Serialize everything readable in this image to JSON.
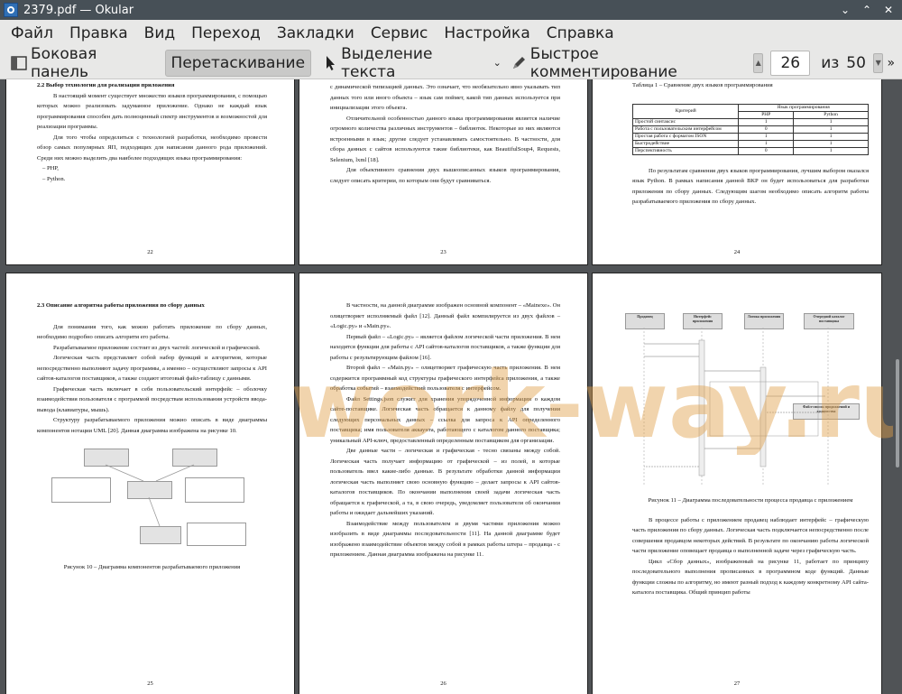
{
  "window": {
    "title": "2379.pdf — Okular"
  },
  "menu": [
    "Файл",
    "Правка",
    "Вид",
    "Переход",
    "Закладки",
    "Сервис",
    "Настройка",
    "Справка"
  ],
  "toolbar": {
    "sidebar_label": "Боковая панель",
    "drag_label": "Перетаскивание",
    "select_text_label": "Выделение текста",
    "quick_annotate_label": "Быстрое комментирование",
    "current_page": "26",
    "of_label": "из",
    "total_pages": "50"
  },
  "watermark": "work-way.ru",
  "pages": {
    "p22": {
      "heading": "2.2 Выбор технологии для реализации приложения",
      "paras": [
        "В настоящий момент существует множество языков программирования, с помощью которых можно реализовать задуманное приложение. Однако не каждый язык программирования способен дать полноценный спектр инструментов и возможностей для реализации программы.",
        "Для того чтобы определиться с технологией разработки, необходимо провести обзор самых популярных ЯП, подходящих для написания данного рода приложений. Среди них можно выделить два наиболее подходящих языка программирования:"
      ],
      "list": [
        "–  PHP,",
        "–  Python."
      ],
      "number": "22"
    },
    "p23": {
      "paras": [
        "с динамической типизацией данных. Это означает, что необязательно явно указывать тип данных того или иного объекта – язык сам поймет, какой тип данных используется при инициализации этого объекта.",
        "Отличительной особенностью данного языка программирования является наличие огромного количества различных инструментов – библиотек. Некоторые из них являются встроенными в язык; другие следует устанавливать самостоятельно. В частности, для сбора данных с сайтов используются такие библиотеки, как BeautifulSoup4, Requests, Selenium, lxml [18].",
        "Для объективного сравнения двух вышеописанных языков программирования, следует описать критерии, по которым они будут сравниваться."
      ],
      "number": "23"
    },
    "p24": {
      "caption": "Таблица 1 – Сравнение двух языков программирования",
      "table": {
        "h_criteria": "Критерий",
        "h_langs": "Язык программирования",
        "h_php": "PHP",
        "h_python": "Python",
        "rows": [
          [
            "Простой синтаксис",
            "1",
            "1"
          ],
          [
            "Работа с пользовательским интерфейсом",
            "0",
            "1"
          ],
          [
            "Простая работа с форматом JSON",
            "1",
            "1"
          ],
          [
            "Быстродействие",
            "1",
            "1"
          ],
          [
            "Перспективность",
            "0",
            "1"
          ]
        ]
      },
      "paras": [
        "По результатам сравнения двух языков программирования, лучшим выбором оказался язык Python. В рамках написания данной ВКР он будет использоваться для разработки приложения по сбору данных. Следующим шагом необходимо описать алгоритм работы разрабатываемого приложения по сбору данных."
      ],
      "number": "24"
    },
    "p25": {
      "heading": "2.3 Описание алгоритма работы приложения по сбору данных",
      "paras": [
        "Для понимания того, как можно работать приложение по сбору данных, необходимо подробно описать алгоритм его работы.",
        "Разрабатываемое приложение состоит из двух частей: логической и графической.",
        "Логическая часть представляет собой набор функций и алгоритмов, которые непосредственно выполняют задачу программы, а именно – осуществляют запросы к API сайтов-каталогов поставщиков, а также создают итоговый файл-таблицу с данными.",
        "Графическая часть включает в себя пользовательский интерфейс – оболочку взаимодействия пользователя с программой посредствам использования устройств ввода-вывода (клавиатуры, мышь).",
        "Структуру разрабатываемого приложения можно описать в виде диаграммы компонентов нотации UML [20]. Данная диаграмма изображена на рисунке 10."
      ],
      "caption": "Рисунок 10 – Диаграмма компонентов разрабатываемого приложения",
      "number": "25"
    },
    "p26": {
      "paras": [
        "В частности, на данной диаграмме изображен основной компонент – «Mainexe». Он олицетворяет исполняемый файл [12]. Данный файл компилируется из двух файлов – «Logic.py» и «Main.py».",
        "Первый файл – «Logic.py» – является файлом логической части приложения. В нем находятся функции для работы с API сайтов-каталогов поставщиков, а также функции для работы с результирующим файлом [16].",
        "Второй файл – «Main.py» – олицетворяет графическую часть приложения. В нем содержится программный код структуры графического интерфейса приложения, а также обработка событий – взаимодействий пользователя с интерфейсом.",
        "Файл Settings.json служит для хранения упорядоченной информации о каждом сайте-поставщике. Логическая часть обращается к данному файлу для получения следующих персональных данных – ссылка для запроса к API определенного поставщика; имя пользователя аккаунта, работающего с каталогом данного поставщика; уникальный API-ключ, предоставленный определенным поставщиком для организации.",
        "Две данные части – логическая и графическая - тесно связаны между собой. Логическая часть получает информацию от графической – из полей, в которые пользователь ввел какие-либо данные. В результате обработки данной информации логическая часть выполняет свою основную функцию – делает запросы к API сайтов-каталогов поставщиков. По окончании выполнения своей задачи логическая часть обращается к графической, а та, в свою очередь, уведомляет пользователя об окончании работы и ожидает дальнейших указаний.",
        "Взаимодействие между пользователем и двумя частями приложения можно изобразить в виде диаграммы последовательности [11]. На данной диаграмме будет изображено взаимодействие объектов между собой в рамках работы штера – продавца - с приложением. Данная диаграмма изображена на рисунке 11."
      ],
      "number": "26"
    },
    "p27": {
      "diagram_headers": [
        "Продавец",
        "Интерфейс приложения",
        "Логика приложения",
        "Очередной каталог поставщика"
      ],
      "diagram_note": "Файл-список продолжений и количества",
      "caption": "Рисунок 11 – Диаграмма последовательности процесса продавца с приложением",
      "paras": [
        "В процессе работы с приложением продавец наблюдает интерфейс – графическую часть приложения по сбору данных. Логическая часть подключается непосредственно после совершения продавцом некоторых действий. В результате по окончанию работы логической части приложение оповещает продавца о выполненной задаче через графическую часть.",
        "Цикл «Сбор данных», изображенный на рисунке 11, работает по принципу последовательного выполнения прописанных в программном коде функций. Данные функции сложны по алгоритму, но имеют разный подход к каждому конкретному API сайта-каталога поставщика. Общий принцип работы"
      ],
      "number": "27"
    }
  }
}
